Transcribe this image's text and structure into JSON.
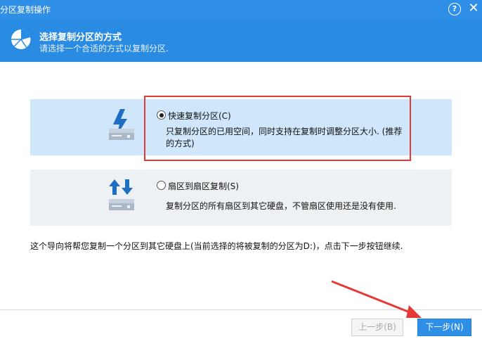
{
  "window": {
    "title": "分区复制操作"
  },
  "titlebar": {
    "help_glyph": "?",
    "close_glyph": "✕"
  },
  "header": {
    "title": "选择复制分区的方式",
    "subtitle": "请选择一个合适的方式以复制分区."
  },
  "options": [
    {
      "label": "快速复制分区(C)",
      "description": "只复制分区的已用空间，同时支持在复制时调整分区大小. (推荐的方式)",
      "selected": true,
      "icon": "lightning-disk-icon"
    },
    {
      "label": "扇区到扇区复制(S)",
      "description": "复制分区的所有扇区到其它硬盘，不管扇区使用还是没有使用.",
      "selected": false,
      "icon": "sector-copy-disk-icon"
    }
  ],
  "hint": "这个导向将帮您复制一个分区到其它硬盘上(当前选择的将被复制的分区为D:)，点击下一步按钮继续.",
  "buttons": {
    "prev_label": "上一步(B)",
    "next_label": "下一步(N)"
  },
  "colors": {
    "accent": "#2f8ee6",
    "selected_option_bg": "#cfe6fb",
    "highlight_box": "#e53935"
  }
}
